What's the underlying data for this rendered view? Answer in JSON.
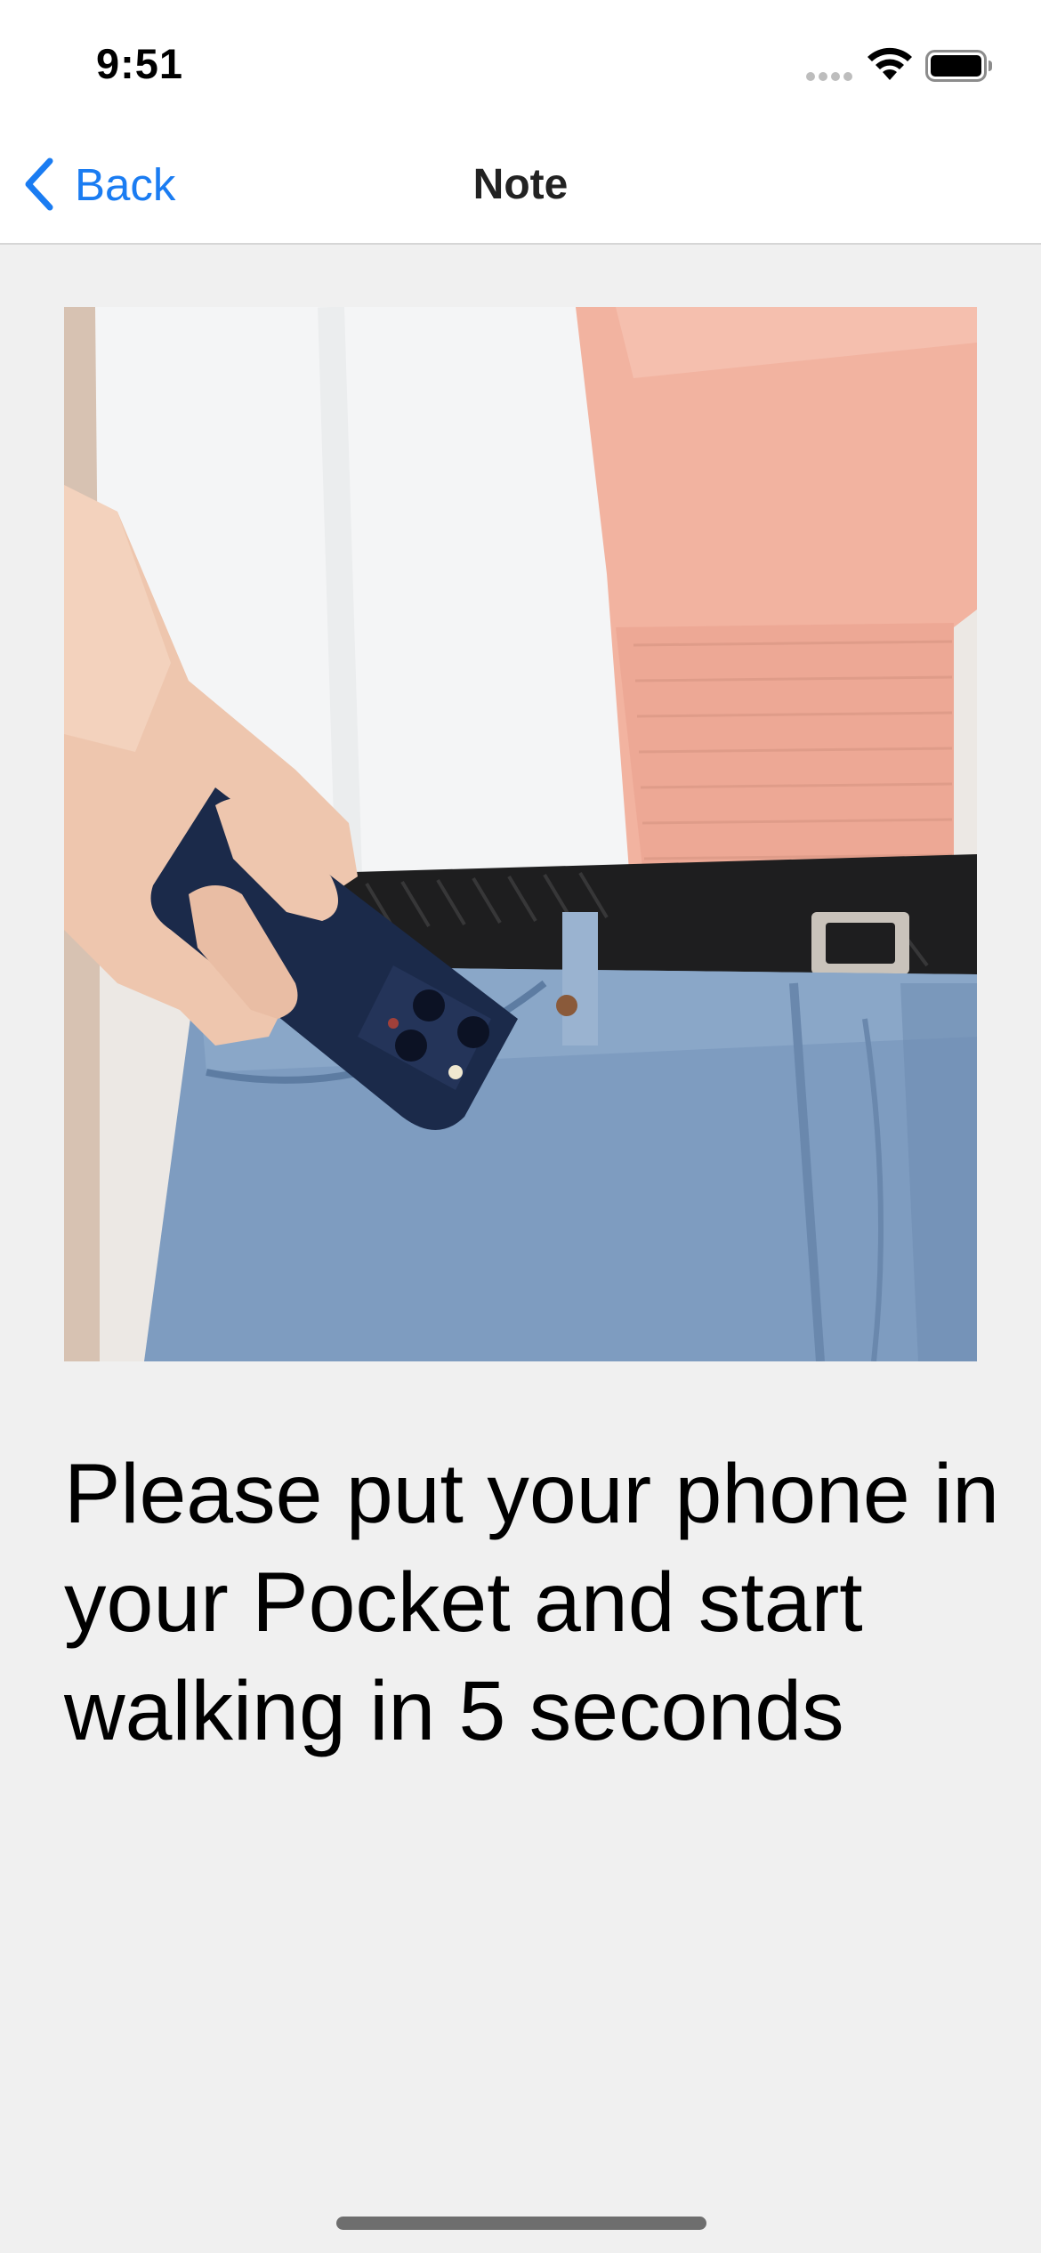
{
  "status_bar": {
    "time": "9:51",
    "icons": [
      "cellular-signal-icon",
      "wifi-icon",
      "battery-icon"
    ]
  },
  "nav": {
    "back_label": "Back",
    "title": "Note",
    "back_icon": "chevron-left-icon"
  },
  "photo": {
    "subject": "hand-putting-phone-in-jeans-pocket-photo"
  },
  "instruction": {
    "text": "Please put your phone in your Pocket and start walking in 5 seconds"
  },
  "colors": {
    "accent": "#1a7cf2",
    "background": "#f0f0f0",
    "bar_background": "#ffffff"
  }
}
